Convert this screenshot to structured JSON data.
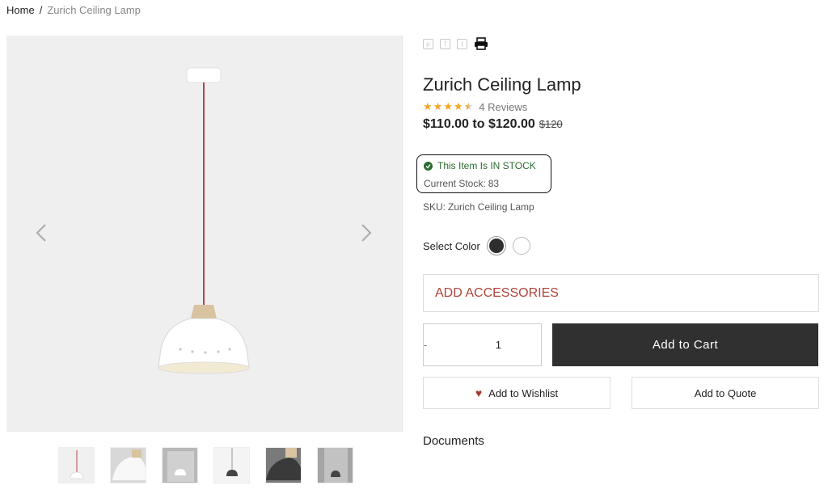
{
  "breadcrumb": {
    "home": "Home",
    "separator": "/",
    "current": "Zurich Ceiling Lamp"
  },
  "share": {
    "icons": [
      "pinterest-icon",
      "facebook-icon",
      "twitter-icon",
      "print-icon"
    ]
  },
  "product": {
    "title": "Zurich Ceiling Lamp",
    "rating": 4.5,
    "reviews_label": "4 Reviews",
    "price_range": "$110.00 to $120.00",
    "price_old": "$120"
  },
  "stock": {
    "status": "This Item Is IN STOCK",
    "current_label": "Current Stock:",
    "current_value": "83",
    "status_color": "#2b6b30"
  },
  "sku": {
    "label": "SKU:",
    "value": "Zurich Ceiling Lamp"
  },
  "color_select": {
    "label": "Select Color",
    "options": [
      "#2e2e2e",
      "#ffffff"
    ]
  },
  "accessories": {
    "label": "ADD ACCESSORIES",
    "color": "#b0443c"
  },
  "quantity": {
    "minus": "-",
    "value": "1",
    "plus": "+"
  },
  "actions": {
    "add_to_cart": "Add to Cart",
    "add_to_wishlist": "Add to Wishlist",
    "add_to_quote": "Add to Quote"
  },
  "documents": {
    "heading": "Documents"
  },
  "colors": {
    "cart_bg": "#303030",
    "accent": "#b0443c",
    "star": "#f5a623",
    "gallery_bg": "#efefef"
  }
}
